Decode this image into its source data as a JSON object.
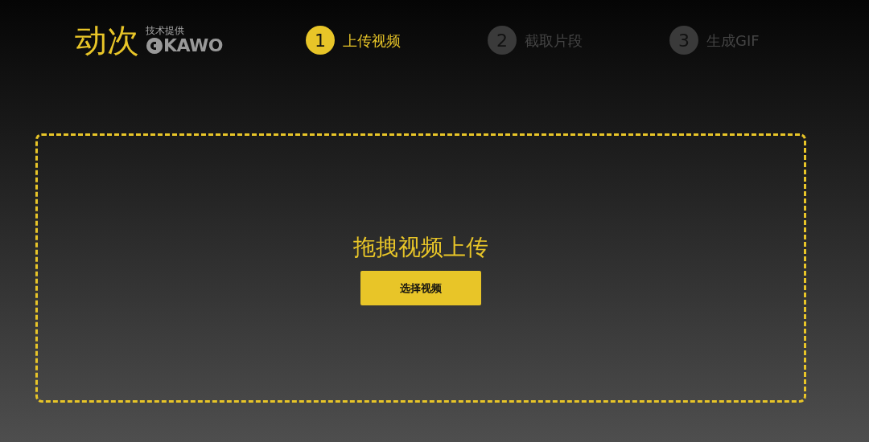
{
  "brand": {
    "name": "动次",
    "credit": "技术提供",
    "partner": "KAWO"
  },
  "steps": [
    {
      "number": "1",
      "label": "上传视频",
      "selected": true
    },
    {
      "number": "2",
      "label": "截取片段",
      "selected": false
    },
    {
      "number": "3",
      "label": "生成GIF",
      "selected": false
    }
  ],
  "dropzone": {
    "title": "拖拽视频上传",
    "button": "选择视频"
  }
}
